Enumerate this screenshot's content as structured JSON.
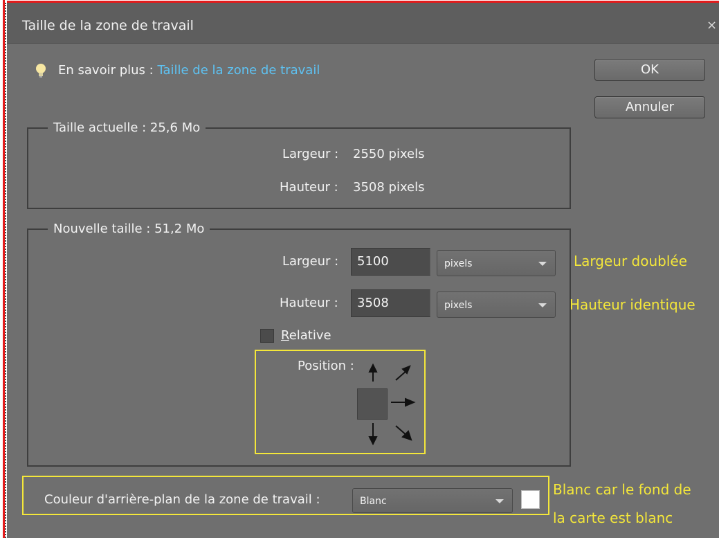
{
  "dialog": {
    "title": "Taille de la zone de travail",
    "close_glyph": "×",
    "learn_more_label": "En savoir plus :",
    "learn_more_link": "Taille de la zone de travail",
    "ok_label": "OK",
    "cancel_label": "Annuler",
    "icon_bulb": "lightbulb-icon"
  },
  "current_size": {
    "legend": "Taille actuelle : 25,6 Mo",
    "width_label": "Largeur :",
    "width_value": "2550 pixels",
    "height_label": "Hauteur :",
    "height_value": "3508 pixels"
  },
  "new_size": {
    "legend": "Nouvelle taille : 51,2 Mo",
    "width_label": "Largeur :",
    "width_value": "5100",
    "width_unit": "pixels",
    "height_label": "Hauteur :",
    "height_value": "3508",
    "height_unit": "pixels",
    "relative_label": "Relative",
    "relative_checked": false,
    "position_label": "Position :"
  },
  "background": {
    "label": "Couleur d'arrière-plan de la zone de travail :",
    "value": "Blanc",
    "swatch_color": "#ffffff"
  },
  "annotations": {
    "width_note": "Largeur doublée",
    "height_note": "Hauteur identique",
    "bg_note_line1": "Blanc car le fond de",
    "bg_note_line2": "la carte est blanc",
    "highlight_color": "#f4e73a"
  }
}
